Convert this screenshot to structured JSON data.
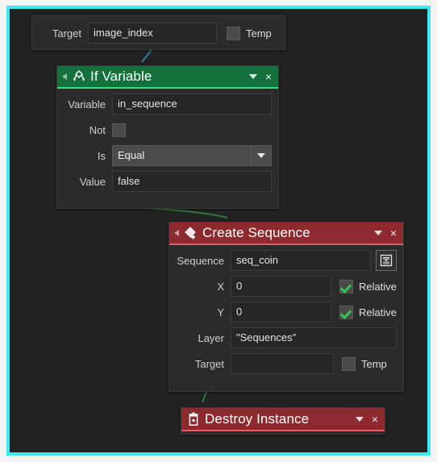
{
  "app": {
    "editor": "visual-script-action-editor",
    "canvas_background": "#222222",
    "selection_border_color": "#3ce9ef"
  },
  "target_block": {
    "label": "Target",
    "value": "image_index",
    "temp_label": "Temp",
    "temp_checked": false
  },
  "nodes": [
    {
      "id": "if-variable",
      "title": "If Variable",
      "icon": "branch-icon",
      "header_color": "#14703c",
      "header_accent": "#2fe07d",
      "caret": "▼",
      "close": "×",
      "fields": [
        {
          "label": "Variable",
          "type": "text",
          "value": "in_sequence"
        },
        {
          "label": "Not",
          "type": "checkbox",
          "checked": false
        },
        {
          "label": "Is",
          "type": "dropdown",
          "value": "Equal"
        },
        {
          "label": "Value",
          "type": "text",
          "value": "false"
        }
      ]
    },
    {
      "id": "create-sequence",
      "title": "Create Sequence",
      "icon": "diamond-plus-icon",
      "header_color": "#8e2a2f",
      "header_accent": "#e85a60",
      "caret": "▼",
      "close": "×",
      "fields": [
        {
          "label": "Sequence",
          "type": "text-with-button",
          "value": "seq_coin",
          "button_icon": "list-picker-icon"
        },
        {
          "label": "X",
          "type": "text-with-checkbox",
          "value": "0",
          "checkbox_label": "Relative",
          "checked": true
        },
        {
          "label": "Y",
          "type": "text-with-checkbox",
          "value": "0",
          "checkbox_label": "Relative",
          "checked": true
        },
        {
          "label": "Layer",
          "type": "text",
          "value": "\"Sequences\""
        },
        {
          "label": "Target",
          "type": "text-with-checkbox",
          "value": "",
          "checkbox_label": "Temp",
          "checked": false
        }
      ]
    },
    {
      "id": "destroy-instance",
      "title": "Destroy Instance",
      "icon": "trash-icon",
      "header_color": "#8e2a2f",
      "header_accent": "#e85a60",
      "caret": "▼",
      "close": "×",
      "fields": []
    }
  ],
  "connectors": [
    {
      "from": "target-block",
      "to": "if-variable",
      "color": "#2e8b9c"
    },
    {
      "from": "if-variable",
      "to": "create-sequence",
      "color": "#2f7a3c"
    },
    {
      "from": "create-sequence",
      "to": "destroy-instance",
      "color": "#2f7a3c"
    }
  ]
}
